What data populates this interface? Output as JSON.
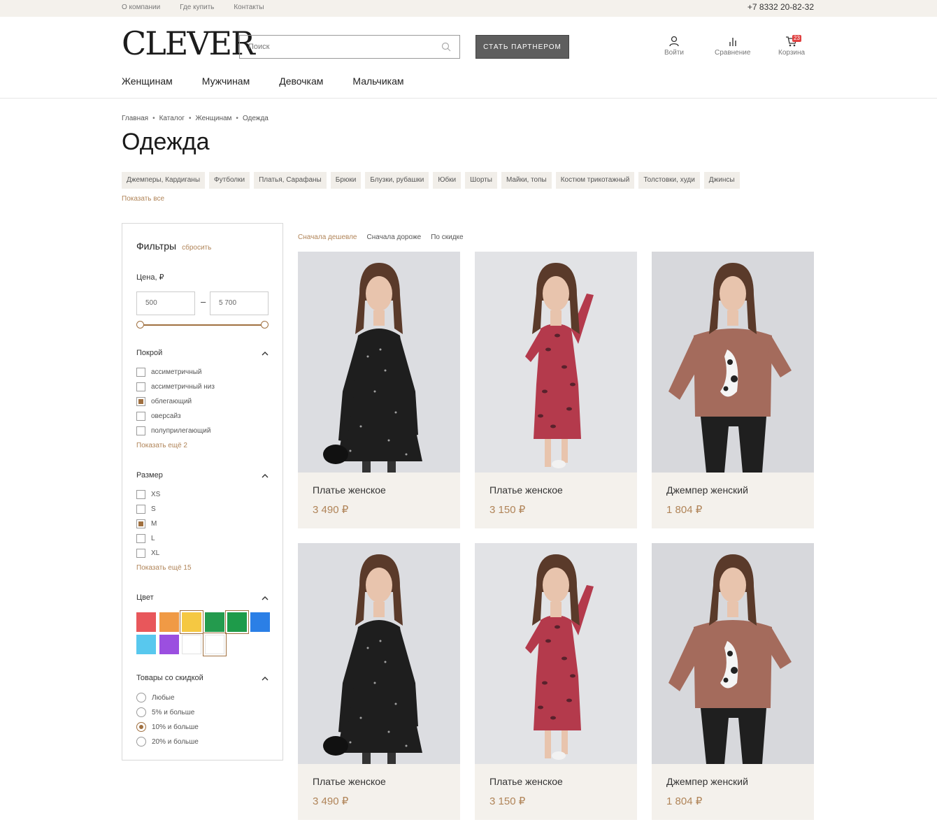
{
  "topbar": {
    "links": [
      "О компании",
      "Где купить",
      "Контакты"
    ],
    "phone": "+7 8332 20-82-32"
  },
  "header": {
    "logo": "CLEVER",
    "search_placeholder": "Поиск",
    "partner_button": "СТАТЬ ПАРТНЕРОМ",
    "login": "Войти",
    "compare": "Сравнение",
    "cart": "Корзина",
    "cart_count": "23"
  },
  "nav": [
    "Женщинам",
    "Мужчинам",
    "Девочкам",
    "Мальчикам"
  ],
  "breadcrumbs": [
    "Главная",
    "Каталог",
    "Женщинам",
    "Одежда"
  ],
  "page_title": "Одежда",
  "categories": [
    "Джемперы, Кардиганы",
    "Футболки",
    "Платья, Сарафаны",
    "Брюки",
    "Блузки, рубашки",
    "Юбки",
    "Шорты",
    "Майки, топы",
    "Костюм трикотажный",
    "Толстовки, худи",
    "Джинсы"
  ],
  "show_all": "Показать все",
  "filters": {
    "title": "Фильтры",
    "reset": "сбросить",
    "price": {
      "label": "Цена, ₽",
      "min": "500",
      "max": "5 700"
    },
    "cut": {
      "title": "Покрой",
      "options": [
        {
          "label": "ассиметричный",
          "checked": false
        },
        {
          "label": "ассиметричный низ",
          "checked": false
        },
        {
          "label": "облегающий",
          "checked": true
        },
        {
          "label": "оверсайз",
          "checked": false
        },
        {
          "label": "полуприлегающий",
          "checked": false
        }
      ],
      "more": "Показать ещё 2"
    },
    "size": {
      "title": "Размер",
      "options": [
        {
          "label": "XS",
          "checked": false
        },
        {
          "label": "S",
          "checked": false
        },
        {
          "label": "M",
          "checked": true
        },
        {
          "label": "L",
          "checked": false
        },
        {
          "label": "XL",
          "checked": false
        }
      ],
      "more": "Показать ещё 15"
    },
    "color": {
      "title": "Цвет",
      "swatches": [
        {
          "hex": "#e8575b",
          "selected": false
        },
        {
          "hex": "#f09a45",
          "selected": false
        },
        {
          "hex": "#f5c842",
          "selected": true
        },
        {
          "hex": "#249b4e",
          "selected": false
        },
        {
          "hex": "#1e9b4a",
          "selected": true
        },
        {
          "hex": "#2b7fe6",
          "selected": false
        },
        {
          "hex": "#58c8ee",
          "selected": false
        },
        {
          "hex": "#9b4fe0",
          "selected": false
        },
        {
          "hex": "#ffffff",
          "selected": false
        },
        {
          "hex": "#ffffff",
          "selected": true
        }
      ]
    },
    "discount": {
      "title": "Товары со скидкой",
      "options": [
        {
          "label": "Любые",
          "checked": false
        },
        {
          "label": "5% и больше",
          "checked": false
        },
        {
          "label": "10% и больше",
          "checked": true
        },
        {
          "label": "20% и больше",
          "checked": false
        }
      ]
    }
  },
  "sort": [
    "Сначала дешевле",
    "Сначала дороже",
    "По скидке"
  ],
  "products": [
    {
      "name": "Платье женское",
      "price": "3 490 ₽",
      "kind": "black-dress"
    },
    {
      "name": "Платье женское",
      "price": "3 150 ₽",
      "kind": "red-dress"
    },
    {
      "name": "Джемпер женский",
      "price": "1 804 ₽",
      "kind": "sweater"
    },
    {
      "name": "Платье женское",
      "price": "3 490 ₽",
      "kind": "black-dress"
    },
    {
      "name": "Платье женское",
      "price": "3 150 ₽",
      "kind": "red-dress"
    },
    {
      "name": "Джемпер женский",
      "price": "1 804 ₽",
      "kind": "sweater"
    }
  ]
}
